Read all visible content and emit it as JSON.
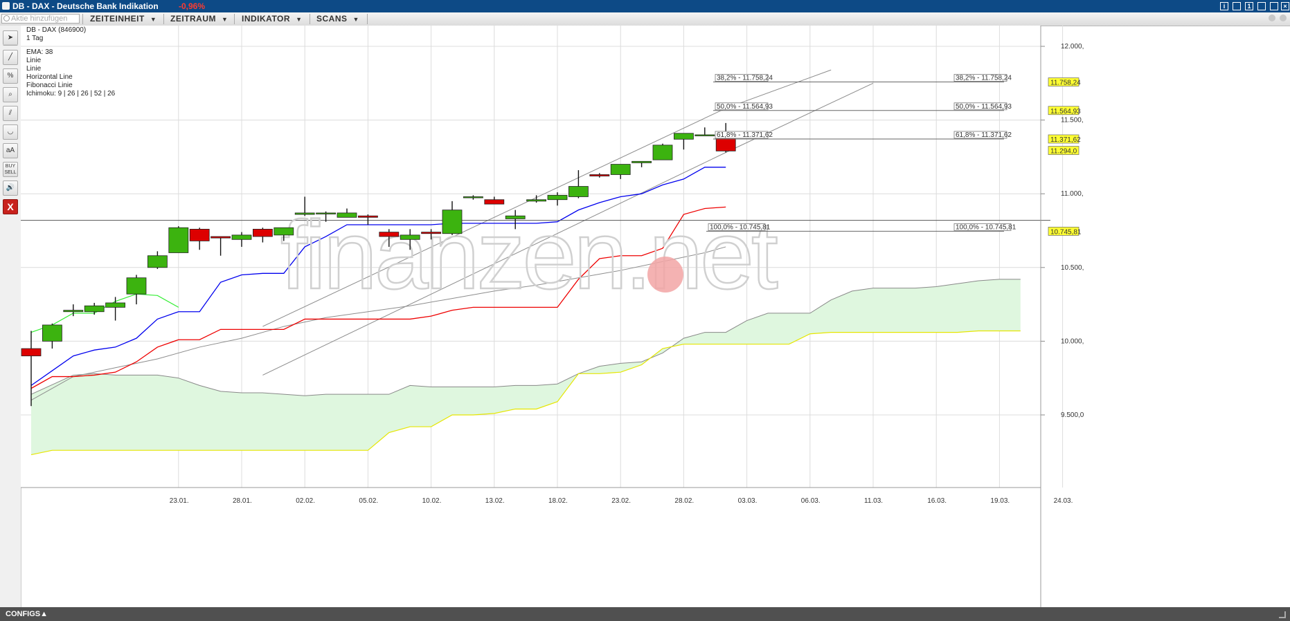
{
  "window": {
    "title": "DB - DAX - Deutsche Bank Indikation",
    "change": "-0,96%"
  },
  "toolbar": {
    "search_placeholder": "Aktie hinzufügen",
    "menus": [
      "ZEITEINHEIT",
      "ZEITRAUM",
      "INDIKATOR",
      "SCANS"
    ]
  },
  "sidebar": {
    "tools": [
      "pointer-icon",
      "line-icon",
      "percent-icon",
      "zoom-icon",
      "channel-icon",
      "arc-icon",
      "text-icon",
      "buy-sell-icon",
      "sound-icon",
      "close-icon"
    ],
    "text_tool": "aA",
    "buy_sell": "BUY SELL",
    "close": "X"
  },
  "info": {
    "instrument": "DB - DAX (846900)",
    "period": "1 Tag",
    "indicators": [
      "EMA: 38",
      "Linie",
      "Linie",
      "Horizontal Line",
      "Fibonacci Linie",
      "Ichimoku: 9 | 26 | 26 | 52 | 26"
    ]
  },
  "watermark": "finanzen.net",
  "footer": {
    "label": "CONFIGS▲"
  },
  "colors": {
    "up": "#3cb30f",
    "down": "#dd0000",
    "tenkan": "#0000ee",
    "kijun": "#ee0000",
    "chikou": "#33ee33",
    "cloud": "#dff7df",
    "price_label_bg": "#ffff33"
  },
  "chart_data": {
    "type": "candlestick",
    "ylim": [
      9250,
      12200
    ],
    "y_ticks": [
      9500,
      10000,
      10500,
      11000,
      11500,
      12000
    ],
    "y_tick_labels": [
      "9.500,0",
      "10.000,",
      "10.500,",
      "11.000,",
      "11.500,",
      "12.000,"
    ],
    "x_ticks": [
      7,
      10,
      13,
      16,
      19,
      22,
      25,
      28,
      31,
      34,
      37,
      40,
      43,
      46,
      49
    ],
    "x_tick_labels": [
      "23.01.",
      "28.01.",
      "02.02.",
      "05.02.",
      "10.02.",
      "13.02.",
      "18.02.",
      "23.02.",
      "28.02.",
      "03.03.",
      "06.03.",
      "11.03.",
      "16.03.",
      "19.03.",
      "24.03."
    ],
    "x_range": [
      0,
      49
    ],
    "candles": [
      {
        "o": 9950,
        "h": 10070,
        "l": 9560,
        "c": 9900
      },
      {
        "o": 10000,
        "h": 10120,
        "l": 9950,
        "c": 10110
      },
      {
        "o": 10200,
        "h": 10250,
        "l": 10170,
        "c": 10210
      },
      {
        "o": 10200,
        "h": 10260,
        "l": 10180,
        "c": 10240
      },
      {
        "o": 10230,
        "h": 10300,
        "l": 10140,
        "c": 10260
      },
      {
        "o": 10320,
        "h": 10450,
        "l": 10250,
        "c": 10430
      },
      {
        "o": 10500,
        "h": 10610,
        "l": 10490,
        "c": 10580
      },
      {
        "o": 10600,
        "h": 10780,
        "l": 10600,
        "c": 10770
      },
      {
        "o": 10760,
        "h": 10770,
        "l": 10620,
        "c": 10680
      },
      {
        "o": 10710,
        "h": 10710,
        "l": 10580,
        "c": 10700
      },
      {
        "o": 10690,
        "h": 10740,
        "l": 10640,
        "c": 10720
      },
      {
        "o": 10760,
        "h": 10770,
        "l": 10670,
        "c": 10710
      },
      {
        "o": 10720,
        "h": 10770,
        "l": 10680,
        "c": 10770
      },
      {
        "o": 10860,
        "h": 10980,
        "l": 10850,
        "c": 10870
      },
      {
        "o": 10870,
        "h": 10880,
        "l": 10810,
        "c": 10870
      },
      {
        "o": 10840,
        "h": 10900,
        "l": 10840,
        "c": 10870
      },
      {
        "o": 10850,
        "h": 10860,
        "l": 10790,
        "c": 10840
      },
      {
        "o": 10740,
        "h": 10760,
        "l": 10640,
        "c": 10710
      },
      {
        "o": 10690,
        "h": 10760,
        "l": 10620,
        "c": 10720
      },
      {
        "o": 10740,
        "h": 10760,
        "l": 10690,
        "c": 10730
      },
      {
        "o": 10730,
        "h": 10950,
        "l": 10720,
        "c": 10890
      },
      {
        "o": 10980,
        "h": 10990,
        "l": 10960,
        "c": 10980
      },
      {
        "o": 10960,
        "h": 10980,
        "l": 10930,
        "c": 10930
      },
      {
        "o": 10830,
        "h": 10890,
        "l": 10760,
        "c": 10850
      },
      {
        "o": 10950,
        "h": 10990,
        "l": 10940,
        "c": 10960
      },
      {
        "o": 10960,
        "h": 11010,
        "l": 10920,
        "c": 10990
      },
      {
        "o": 10980,
        "h": 11160,
        "l": 10970,
        "c": 11050
      },
      {
        "o": 11130,
        "h": 11140,
        "l": 11110,
        "c": 11120
      },
      {
        "o": 11130,
        "h": 11190,
        "l": 11100,
        "c": 11200
      },
      {
        "o": 11210,
        "h": 11220,
        "l": 11180,
        "c": 11220
      },
      {
        "o": 11230,
        "h": 11340,
        "l": 11230,
        "c": 11330
      },
      {
        "o": 11370,
        "h": 11410,
        "l": 11300,
        "c": 11410
      },
      {
        "o": 11400,
        "h": 11450,
        "l": 11400,
        "c": 11400
      },
      {
        "o": 11380,
        "h": 11480,
        "l": 11280,
        "c": 11290
      }
    ],
    "ema38": [
      [
        0,
        9600
      ],
      [
        2,
        9760
      ],
      [
        4,
        9820
      ],
      [
        6,
        9880
      ],
      [
        8,
        9960
      ],
      [
        10,
        10020
      ],
      [
        12,
        10100
      ],
      [
        14,
        10160
      ],
      [
        16,
        10200
      ],
      [
        18,
        10240
      ],
      [
        20,
        10290
      ],
      [
        22,
        10340
      ],
      [
        24,
        10380
      ],
      [
        26,
        10430
      ],
      [
        28,
        10480
      ],
      [
        30,
        10540
      ],
      [
        32,
        10600
      ],
      [
        33,
        10640
      ]
    ],
    "trend_upper": [
      [
        11,
        10100
      ],
      [
        33,
        11580
      ],
      [
        38,
        11840
      ]
    ],
    "trend_lower": [
      [
        11,
        9770
      ],
      [
        33,
        11280
      ],
      [
        40,
        11750
      ]
    ],
    "fib_levels": [
      {
        "label": "38,2% - 11.758,24",
        "value": 11758.24
      },
      {
        "label": "50,0% - 11.564,93",
        "value": 11564.93
      },
      {
        "label": "61,8% - 11.371,62",
        "value": 11371.62
      },
      {
        "label": "100,0% - 10.745,81",
        "value": 10745.81
      }
    ],
    "horizontal_line": 10820,
    "price_labels": [
      "11.758,24",
      "11.564,93",
      "11.371,62",
      "11.294,0",
      "10.745,81"
    ],
    "price_label_values": [
      11758.24,
      11564.93,
      11371.62,
      11294.0,
      10745.81
    ],
    "tenkan": [
      [
        0,
        9700
      ],
      [
        1,
        9800
      ],
      [
        2,
        9900
      ],
      [
        3,
        9940
      ],
      [
        4,
        9960
      ],
      [
        5,
        10020
      ],
      [
        6,
        10150
      ],
      [
        7,
        10200
      ],
      [
        8,
        10200
      ],
      [
        9,
        10400
      ],
      [
        10,
        10450
      ],
      [
        11,
        10460
      ],
      [
        12,
        10460
      ],
      [
        13,
        10640
      ],
      [
        14,
        10710
      ],
      [
        15,
        10790
      ],
      [
        16,
        10790
      ],
      [
        17,
        10790
      ],
      [
        18,
        10790
      ],
      [
        19,
        10790
      ],
      [
        20,
        10800
      ],
      [
        21,
        10800
      ],
      [
        22,
        10800
      ],
      [
        23,
        10800
      ],
      [
        24,
        10800
      ],
      [
        25,
        10810
      ],
      [
        26,
        10890
      ],
      [
        27,
        10940
      ],
      [
        28,
        10980
      ],
      [
        29,
        11000
      ],
      [
        30,
        11060
      ],
      [
        31,
        11100
      ],
      [
        32,
        11180
      ],
      [
        33,
        11180
      ]
    ],
    "kijun": [
      [
        0,
        9680
      ],
      [
        1,
        9760
      ],
      [
        2,
        9760
      ],
      [
        3,
        9770
      ],
      [
        4,
        9790
      ],
      [
        5,
        9860
      ],
      [
        6,
        9960
      ],
      [
        7,
        10010
      ],
      [
        8,
        10010
      ],
      [
        9,
        10080
      ],
      [
        10,
        10080
      ],
      [
        11,
        10080
      ],
      [
        12,
        10080
      ],
      [
        13,
        10150
      ],
      [
        14,
        10150
      ],
      [
        15,
        10150
      ],
      [
        16,
        10150
      ],
      [
        17,
        10150
      ],
      [
        18,
        10150
      ],
      [
        19,
        10170
      ],
      [
        20,
        10210
      ],
      [
        21,
        10230
      ],
      [
        22,
        10230
      ],
      [
        23,
        10230
      ],
      [
        24,
        10230
      ],
      [
        25,
        10230
      ],
      [
        26,
        10420
      ],
      [
        27,
        10560
      ],
      [
        28,
        10580
      ],
      [
        29,
        10580
      ],
      [
        30,
        10630
      ],
      [
        31,
        10860
      ],
      [
        32,
        10900
      ],
      [
        33,
        10910
      ]
    ],
    "chikou": [
      [
        0,
        10060
      ],
      [
        1,
        10110
      ],
      [
        2,
        10190
      ],
      [
        3,
        10190
      ],
      [
        4,
        10270
      ],
      [
        5,
        10320
      ],
      [
        6,
        10310
      ],
      [
        7,
        10230
      ]
    ],
    "span_a": [
      [
        0,
        9640
      ],
      [
        2,
        9770
      ],
      [
        3,
        9780
      ],
      [
        4,
        9770
      ],
      [
        5,
        9770
      ],
      [
        6,
        9770
      ],
      [
        7,
        9750
      ],
      [
        8,
        9700
      ],
      [
        9,
        9660
      ],
      [
        10,
        9650
      ],
      [
        11,
        9650
      ],
      [
        12,
        9640
      ],
      [
        13,
        9630
      ],
      [
        14,
        9640
      ],
      [
        15,
        9640
      ],
      [
        16,
        9640
      ],
      [
        17,
        9640
      ],
      [
        18,
        9700
      ],
      [
        19,
        9690
      ],
      [
        20,
        9690
      ],
      [
        21,
        9690
      ],
      [
        22,
        9690
      ],
      [
        23,
        9700
      ],
      [
        24,
        9700
      ],
      [
        25,
        9710
      ],
      [
        26,
        9780
      ],
      [
        27,
        9830
      ],
      [
        28,
        9850
      ],
      [
        29,
        9860
      ],
      [
        30,
        9920
      ],
      [
        31,
        10020
      ],
      [
        32,
        10060
      ],
      [
        33,
        10060
      ],
      [
        34,
        10140
      ],
      [
        35,
        10190
      ],
      [
        36,
        10190
      ],
      [
        37,
        10190
      ],
      [
        38,
        10280
      ],
      [
        39,
        10340
      ],
      [
        40,
        10360
      ],
      [
        41,
        10360
      ],
      [
        42,
        10360
      ],
      [
        43,
        10370
      ],
      [
        44,
        10390
      ],
      [
        45,
        10410
      ],
      [
        46,
        10420
      ],
      [
        47,
        10420
      ]
    ],
    "span_b": [
      [
        0,
        9230
      ],
      [
        1,
        9260
      ],
      [
        2,
        9260
      ],
      [
        3,
        9260
      ],
      [
        4,
        9260
      ],
      [
        5,
        9260
      ],
      [
        6,
        9260
      ],
      [
        7,
        9260
      ],
      [
        8,
        9260
      ],
      [
        9,
        9260
      ],
      [
        10,
        9260
      ],
      [
        11,
        9260
      ],
      [
        12,
        9260
      ],
      [
        13,
        9260
      ],
      [
        14,
        9260
      ],
      [
        15,
        9260
      ],
      [
        16,
        9260
      ],
      [
        17,
        9380
      ],
      [
        18,
        9420
      ],
      [
        19,
        9420
      ],
      [
        20,
        9500
      ],
      [
        21,
        9500
      ],
      [
        22,
        9510
      ],
      [
        23,
        9540
      ],
      [
        24,
        9540
      ],
      [
        25,
        9590
      ],
      [
        26,
        9780
      ],
      [
        27,
        9780
      ],
      [
        28,
        9790
      ],
      [
        29,
        9840
      ],
      [
        30,
        9950
      ],
      [
        31,
        9980
      ],
      [
        32,
        9980
      ],
      [
        33,
        9980
      ],
      [
        34,
        9980
      ],
      [
        35,
        9980
      ],
      [
        36,
        9980
      ],
      [
        37,
        10050
      ],
      [
        38,
        10060
      ],
      [
        39,
        10060
      ],
      [
        40,
        10060
      ],
      [
        41,
        10060
      ],
      [
        42,
        10060
      ],
      [
        43,
        10060
      ],
      [
        44,
        10060
      ],
      [
        45,
        10070
      ],
      [
        46,
        10070
      ],
      [
        47,
        10070
      ]
    ]
  }
}
